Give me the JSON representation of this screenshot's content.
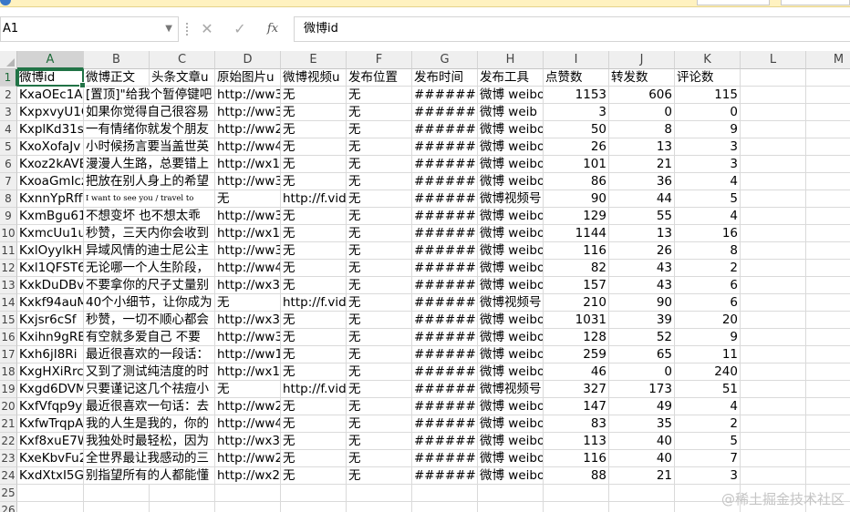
{
  "formula_bar": {
    "cell_ref": "A1",
    "content": "微博id"
  },
  "columns": [
    "A",
    "B",
    "C",
    "D",
    "E",
    "F",
    "G",
    "H",
    "I",
    "J",
    "K",
    "L",
    "M"
  ],
  "rows": [
    [
      "微博id",
      "微博正文",
      "头条文章u",
      "原始图片u",
      "微博视频u",
      "发布位置",
      "发布时间",
      "发布工具",
      "点赞数",
      "转发数",
      "评论数"
    ],
    [
      "KxaOEc1Ai",
      "[置顶]\"给我个暂停键吧",
      "http://ww3",
      "无",
      "无",
      "#######",
      "微博 weibo",
      "1153",
      "606",
      "115"
    ],
    [
      "KxpxvyU1C",
      "如果你觉得自己很容易",
      "http://ww3",
      "无",
      "无",
      "#######",
      "微博  weib",
      "3",
      "0",
      "0"
    ],
    [
      "KxplKd31s",
      "一有情绪你就发个朋友",
      "http://ww2",
      "无",
      "无",
      "#######",
      "微博 weibo",
      "50",
      "8",
      "9"
    ],
    [
      "KxoXofaJv",
      "小时候扬言要当盖世英",
      "http://ww4",
      "无",
      "无",
      "#######",
      "微博 weibo",
      "26",
      "13",
      "3"
    ],
    [
      "Kxoz2kAVE",
      "漫漫人生路，总要错上",
      "http://wx1",
      "无",
      "无",
      "#######",
      "微博 weibo",
      "101",
      "21",
      "3"
    ],
    [
      "KxoaGmIcz",
      "把放在别人身上的希望",
      "http://ww3",
      "无",
      "无",
      "#######",
      "微博 weibo",
      "86",
      "36",
      "4"
    ],
    [
      "KxnnYpRff",
      "I want to see you / travel to",
      "无",
      "http://f.vid",
      "无",
      "#######",
      "微博视频号",
      "90",
      "44",
      "5"
    ],
    [
      "KxmBgu61",
      "不想变坏 也不想太乖",
      "http://ww3",
      "无",
      "无",
      "#######",
      "微博 weibo",
      "129",
      "55",
      "4"
    ],
    [
      "KxmcUu1u",
      "秒赞，三天内你会收到",
      "http://wx1",
      "无",
      "无",
      "#######",
      "微博 weibo",
      "1144",
      "13",
      "16"
    ],
    [
      "KxlOyylkH",
      "异域风情的迪士尼公主",
      "http://ww3",
      "无",
      "无",
      "#######",
      "微博 weibo",
      "116",
      "26",
      "8"
    ],
    [
      "Kxl1QFST6",
      "无论哪一个人生阶段，",
      "http://ww4",
      "无",
      "无",
      "#######",
      "微博 weibo",
      "82",
      "43",
      "2"
    ],
    [
      "KxkDuDBv0",
      "不要拿你的尺子丈量别",
      "http://wx3",
      "无",
      "无",
      "#######",
      "微博 weibo",
      "157",
      "43",
      "6"
    ],
    [
      "Kxkf94auM",
      "40个小细节，让你成为",
      "无",
      "http://f.vid",
      "无",
      "#######",
      "微博视频号",
      "210",
      "90",
      "6"
    ],
    [
      "Kxjsr6cSf",
      "秒赞，一切不顺心都会",
      "http://wx3",
      "无",
      "无",
      "#######",
      "微博 weibo",
      "1031",
      "39",
      "20"
    ],
    [
      "Kxihn9gRB",
      "有空就多爱自己 不要",
      "http://ww3",
      "无",
      "无",
      "#######",
      "微博 weibo",
      "128",
      "52",
      "9"
    ],
    [
      "Kxh6jI8Ri",
      "最近很喜欢的一段话：",
      "http://ww1",
      "无",
      "无",
      "#######",
      "微博 weibo",
      "259",
      "65",
      "11"
    ],
    [
      "KxgHXiRrc",
      "又到了测试纯洁度的时",
      "http://wx1",
      "无",
      "无",
      "#######",
      "微博 weibo",
      "46",
      "0",
      "240"
    ],
    [
      "Kxgd6DVM",
      "只要谨记这几个祛痘小",
      "无",
      "http://f.vid",
      "无",
      "#######",
      "微博视频号",
      "327",
      "173",
      "51"
    ],
    [
      "KxfVfqp9y",
      "最近很喜欢一句话：去",
      "http://ww2",
      "无",
      "无",
      "#######",
      "微博 weibo",
      "147",
      "49",
      "4"
    ],
    [
      "KxfwTrqpA",
      "我的人生是我的，你的",
      "http://ww4",
      "无",
      "无",
      "#######",
      "微博 weibo",
      "83",
      "35",
      "2"
    ],
    [
      "Kxf8xuE7W",
      "我独处时最轻松，因为",
      "http://wx3",
      "无",
      "无",
      "#######",
      "微博 weibo",
      "113",
      "40",
      "5"
    ],
    [
      "KxeKbvFu2",
      "全世界最让我感动的三",
      "http://ww2",
      "无",
      "无",
      "#######",
      "微博 weibo",
      "116",
      "40",
      "7"
    ],
    [
      "KxdXtxI5G",
      "别指望所有的人都能懂",
      "http://wx2",
      "无",
      "无",
      "#######",
      "微博 weibo",
      "88",
      "21",
      "3"
    ]
  ],
  "row_numbers": [
    "1",
    "2",
    "3",
    "4",
    "5",
    "6",
    "7",
    "8",
    "9",
    "10",
    "11",
    "12",
    "13",
    "14",
    "15",
    "16",
    "17",
    "18",
    "19",
    "20",
    "21",
    "22",
    "23",
    "24",
    "25",
    "26"
  ],
  "watermark": "@稀土掘金技术社区",
  "colors": {
    "accent": "#217346",
    "header_bg": "#efefef",
    "notice_bar": "#fff2c0"
  }
}
